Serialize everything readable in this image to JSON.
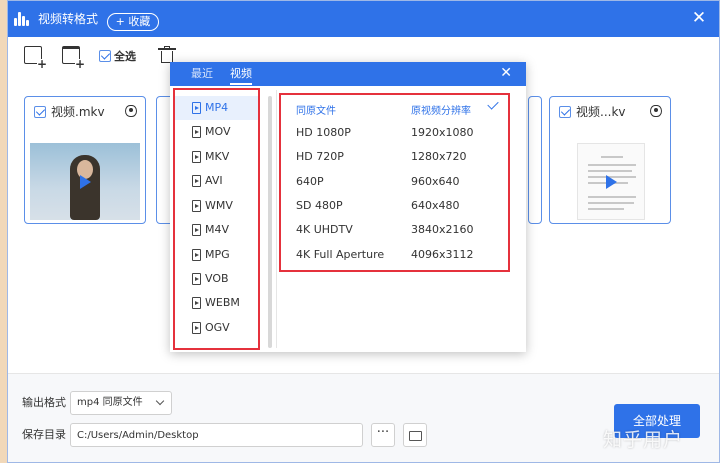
{
  "app": {
    "title": "视频转格式",
    "favorite_label": "+ 收藏",
    "close_symbol": "✕"
  },
  "toolbar": {
    "select_all_label": "全选"
  },
  "files": [
    {
      "name": "视频.mkv",
      "thumbnail": "video",
      "checked": true
    },
    {
      "name": "视频...kv",
      "thumbnail": "document",
      "checked": true
    }
  ],
  "popup": {
    "tabs": [
      {
        "label": "最近",
        "active": false
      },
      {
        "label": "视频",
        "active": true
      }
    ],
    "close_symbol": "✕",
    "formats": [
      {
        "label": "MP4",
        "selected": true
      },
      {
        "label": "MOV",
        "selected": false
      },
      {
        "label": "MKV",
        "selected": false
      },
      {
        "label": "AVI",
        "selected": false
      },
      {
        "label": "WMV",
        "selected": false
      },
      {
        "label": "M4V",
        "selected": false
      },
      {
        "label": "MPG",
        "selected": false
      },
      {
        "label": "VOB",
        "selected": false
      },
      {
        "label": "WEBM",
        "selected": false
      },
      {
        "label": "OGV",
        "selected": false
      }
    ],
    "resolution_header": {
      "preset": "同原文件",
      "resolution": "原视频分辨率",
      "selected": true
    },
    "resolutions": [
      {
        "preset": "HD 1080P",
        "resolution": "1920x1080"
      },
      {
        "preset": "HD 720P",
        "resolution": "1280x720"
      },
      {
        "preset": "640P",
        "resolution": "960x640"
      },
      {
        "preset": "SD 480P",
        "resolution": "640x480"
      },
      {
        "preset": "4K UHDTV",
        "resolution": "3840x2160"
      },
      {
        "preset": "4K Full Aperture",
        "resolution": "4096x3112"
      }
    ]
  },
  "bottom": {
    "output_format_label": "输出格式",
    "output_format_value": "mp4 同原文件",
    "save_dir_label": "保存目录",
    "save_dir_value": "C:/Users/Admin/Desktop",
    "more_label": "···",
    "convert_label": "全部处理"
  },
  "watermark": "知乎用户",
  "colors": {
    "accent": "#2f72e8",
    "highlight_red": "#e5313c"
  }
}
